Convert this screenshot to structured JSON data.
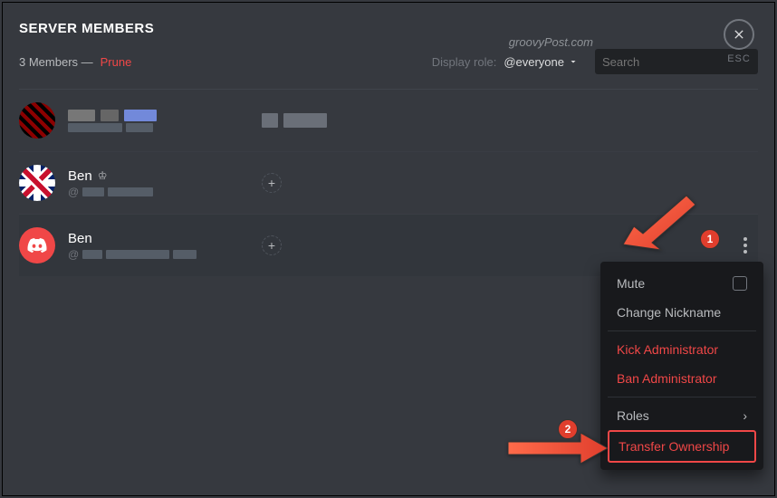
{
  "header": {
    "title": "SERVER MEMBERS",
    "member_count": "3 Members —",
    "prune": "Prune",
    "display_role_label": "Display role:",
    "role_value": "@everyone",
    "search_placeholder": "Search",
    "esc_label": "ESC"
  },
  "watermark": "groovyPost.com",
  "members": [
    {
      "name": "",
      "handle": "@"
    },
    {
      "name": "Ben",
      "handle": "@",
      "owner": true
    },
    {
      "name": "Ben",
      "handle": "@"
    }
  ],
  "menu": {
    "mute": "Mute",
    "nickname": "Change Nickname",
    "kick": "Kick Administrator",
    "ban": "Ban Administrator",
    "roles": "Roles",
    "transfer": "Transfer Ownership"
  },
  "annotations": {
    "step1": "1",
    "step2": "2"
  }
}
